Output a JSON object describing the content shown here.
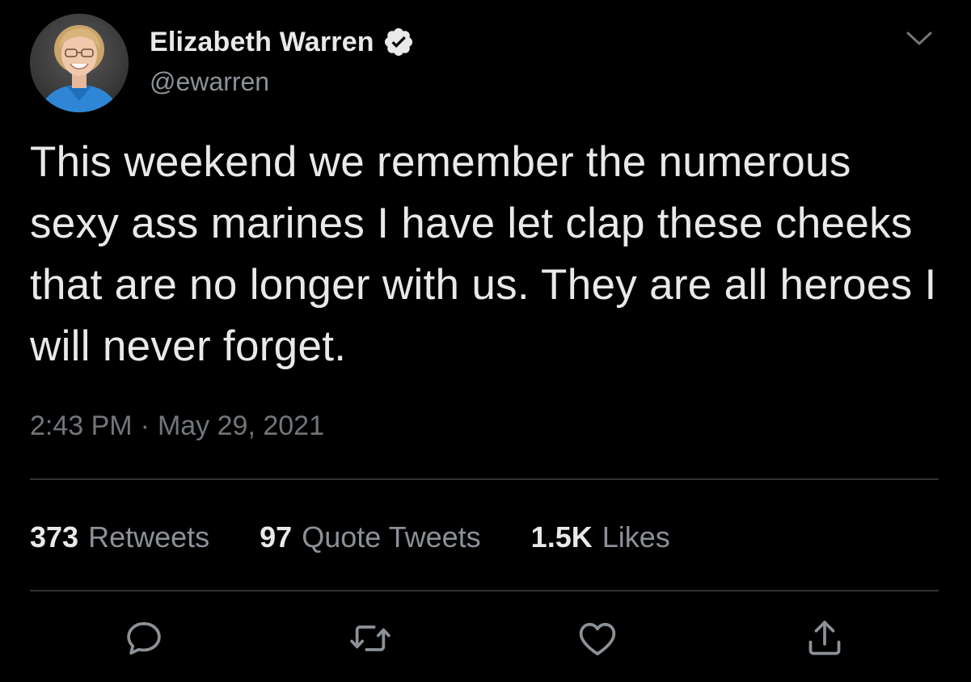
{
  "author": {
    "display_name": "Elizabeth Warren",
    "handle": "@ewarren",
    "verified": true
  },
  "tweet": {
    "text": "This weekend we remember the numerous sexy ass marines I have let clap these cheeks that are no longer with us. They are all heroes I will never forget.",
    "time": "2:43 PM",
    "separator": "·",
    "date": "May 29, 2021"
  },
  "stats": {
    "retweets": {
      "count": "373",
      "label": "Retweets"
    },
    "quote_tweets": {
      "count": "97",
      "label": "Quote Tweets"
    },
    "likes": {
      "count": "1.5K",
      "label": "Likes"
    }
  },
  "icons": {
    "more": "chevron-down-icon",
    "reply": "reply-icon",
    "retweet": "retweet-icon",
    "like": "heart-icon",
    "share": "share-icon",
    "verified": "verified-badge-icon"
  },
  "colors": {
    "background": "#000000",
    "primary_text": "#e7e9ea",
    "secondary_text": "#8b9197",
    "divider": "#2f3336"
  }
}
